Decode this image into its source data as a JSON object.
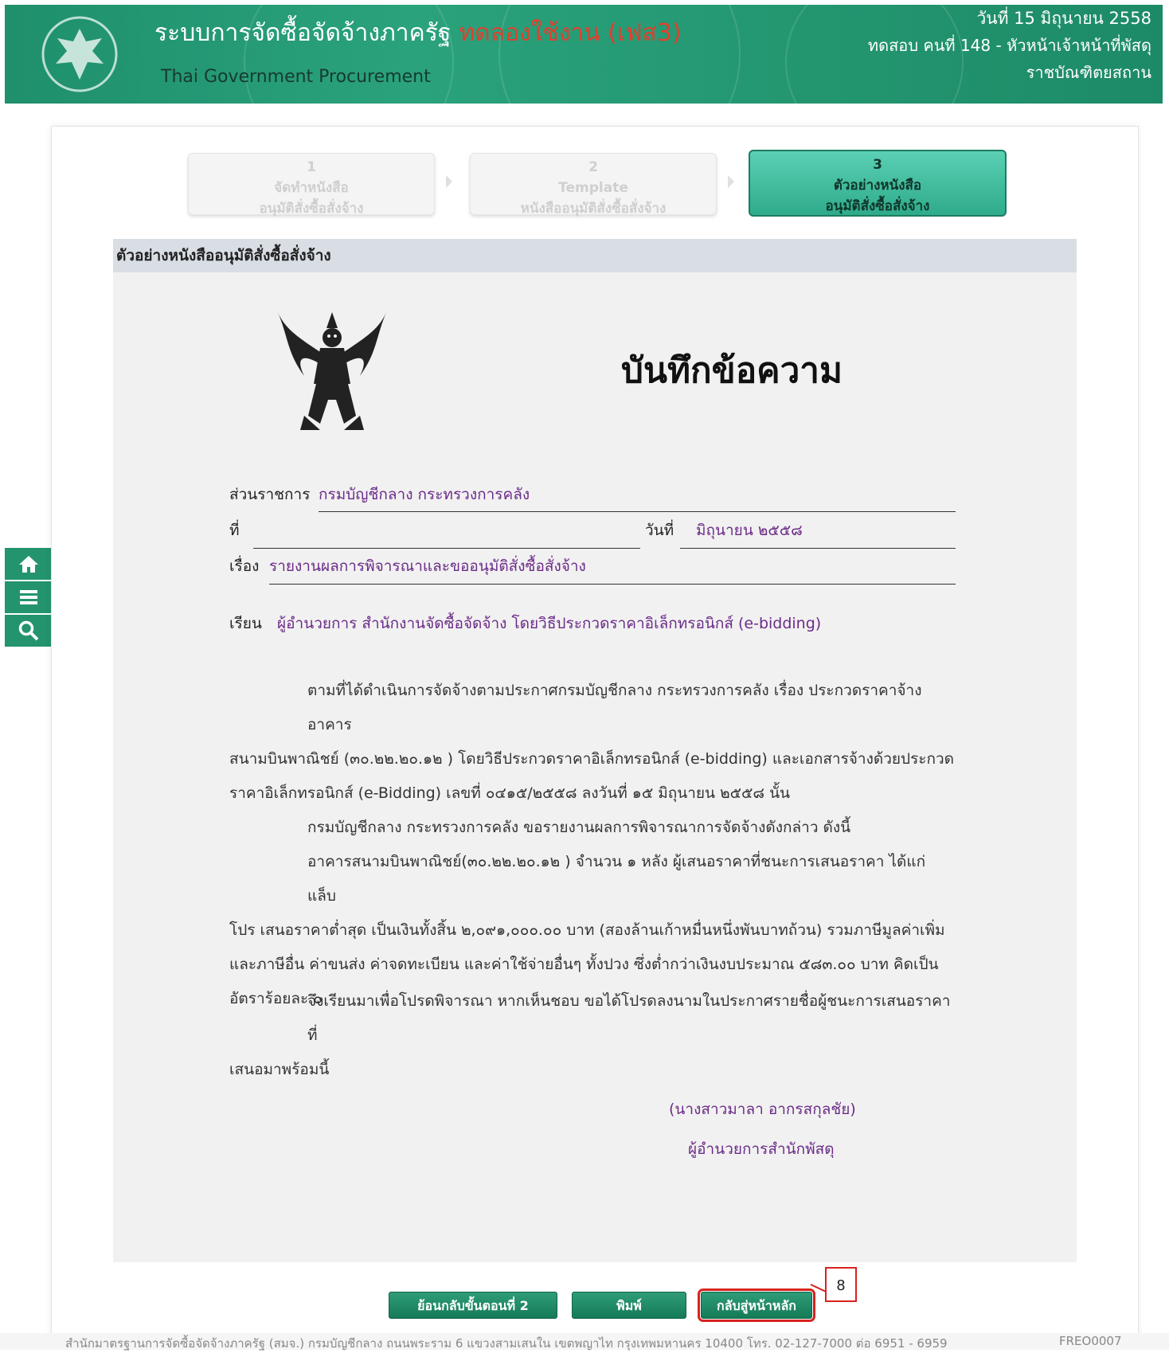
{
  "header": {
    "title": "ระบบการจัดซื้อจัดจ้างภาครัฐ",
    "trial_label": "ทดลองใช้งาน (เฟส3)",
    "subtitle": "Thai Government Procurement",
    "date": "วันที่ 15 มิถุนายน 2558",
    "user": "ทดสอบ คนที่ 148 - หัวหน้าเจ้าหน้าที่พัสดุ",
    "agency": "ราชบัณฑิตยสถาน",
    "logo_icon": "garuda-seal-logo"
  },
  "sidenav": {
    "items": [
      {
        "icon": "home-icon"
      },
      {
        "icon": "menu-icon"
      },
      {
        "icon": "search-icon"
      }
    ]
  },
  "steps": [
    {
      "num": "1",
      "line1": "จัดทำหนังสือ",
      "line2": "อนุมัติสั่งซื้อสั่งจ้าง",
      "state": "disabled"
    },
    {
      "num": "2",
      "line1": "Template",
      "line2": "หนังสืออนุมัติสั่งซื้อสั่งจ้าง",
      "state": "disabled"
    },
    {
      "num": "3",
      "line1": "ตัวอย่างหนังสือ",
      "line2": "อนุมัติสั่งซื้อสั่งจ้าง",
      "state": "active"
    }
  ],
  "section_title": "ตัวอย่างหนังสืออนุมัติสั่งซื้อสั่งจ้าง",
  "memo": {
    "title": "บันทึกข้อความ",
    "agency_label": "ส่วนราชการ",
    "agency_value": "กรมบัญชีกลาง กระทรวงการคลัง",
    "ref_label": "ที่",
    "date_label": "วันที่",
    "date_value": "มิถุนายน ๒๕๕๘",
    "subject_label": "เรื่อง",
    "subject_value": "รายงานผลการพิจารณาและขออนุมัติสั่งซื้อสั่งจ้าง",
    "to_label": "เรียน",
    "to_value": "ผู้อำนวยการ สำนักงานจัดซื้อจัดจ้าง โดยวิธีประกวดราคาอิเล็กทรอนิกส์ (e-bidding)",
    "para1_l1": "ตามที่ได้ดำเนินการจัดจ้างตามประกาศกรมบัญชีกลาง กระทรวงการคลัง เรื่อง ประกวดราคาจ้างอาคาร",
    "para1_l2": "สนามบินพาณิชย์ (๓๐.๒๒.๒๐.๑๒ ) โดยวิธีประกวดราคาอิเล็กทรอนิกส์ (e-bidding) และเอกสารจ้างด้วยประกวด",
    "para1_l3": "ราคาอิเล็กทรอนิกส์ (e-Bidding) เลขที่ ๐๔๑๕/๒๕๕๘ ลงวันที่ ๑๕ มิถุนายน ๒๕๕๘ นั้น",
    "para2": "กรมบัญชีกลาง กระทรวงการคลัง ขอรายงานผลการพิจารณาการจัดจ้างดังกล่าว ดังนี้",
    "para3_l1": "อาคารสนามบินพาณิชย์(๓๐.๒๒.๒๐.๑๒ ) จำนวน ๑ หลัง ผู้เสนอราคาที่ชนะการเสนอราคา ได้แก่ แล็บ",
    "para3_l2": "โปร เสนอราคาต่ำสุด เป็นเงินทั้งสิ้น ๒,๐๙๑,๐๐๐.๐๐ บาท (สองล้านเก้าหมื่นหนึ่งพันบาทถ้วน) รวมภาษีมูลค่าเพิ่ม",
    "para3_l3": "และภาษีอื่น ค่าขนส่ง ค่าจดทะเบียน และค่าใช้จ่ายอื่นๆ ทั้งปวง ซึ่งต่ำกว่าเงินงบประมาณ ๕๘๓.๐๐ บาท คิดเป็น",
    "para3_l4": "อัตราร้อยละ ๐",
    "para4_l1": "จึงเรียนมาเพื่อโปรดพิจารณา หากเห็นชอบ ขอได้โปรดลงนามในประกาศรายชื่อผู้ชนะการเสนอราคาที่",
    "para4_l2": "เสนอมาพร้อมนี้",
    "signer_name": "(นางสาวมาลา อากรสกุลชัย)",
    "signer_title": "ผู้อำนวยการสำนักพัสดุ"
  },
  "buttons": {
    "back": "ย้อนกลับขั้นตอนที่ 2",
    "print": "พิมพ์",
    "home": "กลับสู่หน้าหลัก"
  },
  "callout": "8",
  "footer": {
    "address": "สำนักมาตรฐานการจัดซื้อจัดจ้างภาครัฐ (สมจ.) กรมบัญชีกลาง ถนนพระราม 6 แขวงสามเสนใน เขตพญาไท กรุงเทพมหานคร 10400 โทร. 02-127-7000 ต่อ 6951 - 6959",
    "code": "FREO0007"
  },
  "colors": {
    "header_green": "#239670",
    "button_green": "#1f8a64",
    "value_purple": "#6b2b88",
    "highlight_red": "#d8221e"
  }
}
